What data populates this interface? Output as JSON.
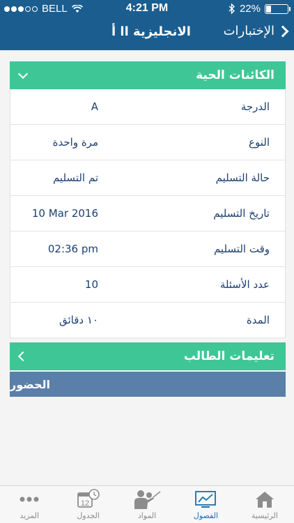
{
  "status": {
    "carrier": "BELL",
    "time": "4:21 PM",
    "battery": "22%",
    "battery_level": 0.22
  },
  "nav": {
    "title": "الانجليزية اا أ",
    "back_label": "الإختبارات"
  },
  "section": {
    "title": "الكائنات الحية",
    "rows": [
      {
        "label": "الدرجة",
        "value": "A"
      },
      {
        "label": "النوع",
        "value": "مرة واحدة"
      },
      {
        "label": "حالة التسليم",
        "value": "تم التسليم"
      },
      {
        "label": "تاريخ التسليم",
        "value": "10 Mar 2016"
      },
      {
        "label": "وقت التسليم",
        "value": "02:36 pm"
      },
      {
        "label": "عدد الأسئلة",
        "value": "10"
      },
      {
        "label": "المدة",
        "value": "١٠ دقائق"
      }
    ]
  },
  "instructions": {
    "title": "تعليمات الطالب"
  },
  "attendance": {
    "title": "الحضور"
  },
  "tabs": [
    {
      "label": "المزيد",
      "icon": "more-icon"
    },
    {
      "label": "الجدول",
      "icon": "calendar-icon",
      "day": "12"
    },
    {
      "label": "المواد",
      "icon": "teacher-icon"
    },
    {
      "label": "الفصول",
      "icon": "chart-icon",
      "active": true
    },
    {
      "label": "الرئيسية",
      "icon": "home-icon"
    }
  ],
  "colors": {
    "header": "#1b5d8f",
    "accent_green": "#3fc697",
    "attendance": "#5a7fa9",
    "active_tab": "#1b6fae"
  }
}
